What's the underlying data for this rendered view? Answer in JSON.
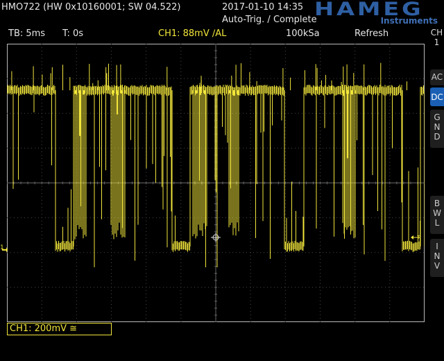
{
  "header": {
    "device_info": "HMO722 (HW 0x10160001; SW 04.522)",
    "datetime": "2017-01-10 14:35",
    "trigger_status": "Auto-Trig. / Complete",
    "brand_logo": "HAMEG",
    "brand_sub": "Instruments"
  },
  "status_bar": {
    "timebase": "TB: 5ms",
    "trigger_time": "T: 0s",
    "ch1_trigger": "CH1: 88mV ∕AL",
    "sample_rate": "100kSa",
    "acquisition_mode": "Refresh"
  },
  "side_panel": {
    "channel_label": "CH\n1",
    "buttons": [
      {
        "label": "AC",
        "active": false
      },
      {
        "label": "DC",
        "active": true
      },
      {
        "label": "G\nN\nD",
        "active": false
      },
      {
        "label": "B\nW\nL",
        "active": false
      },
      {
        "label": "I\nN\nV",
        "active": false
      }
    ]
  },
  "bottom": {
    "ch1_setting": "CH1: 200mV ≅"
  },
  "markers": {
    "ground_marker": "1",
    "trigger_position_marker": "T"
  },
  "colors": {
    "trace": "#f2e63b",
    "grid": "#4a4a4a",
    "accent": "#1a5fb4",
    "brand": "#2e5fa3"
  }
}
